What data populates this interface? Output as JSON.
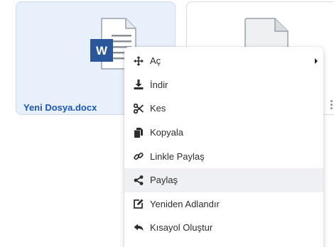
{
  "files": [
    {
      "name": "Yeni Dosya.docx",
      "icon": "word-document-icon",
      "selected": true,
      "accent": "#2b579a"
    },
    {
      "name": "",
      "icon": "generic-document-icon",
      "selected": false
    }
  ],
  "context_menu": {
    "items": [
      {
        "label": "Aç",
        "icon": "move-arrows-icon",
        "has_submenu": true
      },
      {
        "label": "İndir",
        "icon": "download-icon"
      },
      {
        "label": "Kes",
        "icon": "scissors-icon"
      },
      {
        "label": "Kopyala",
        "icon": "copy-icon"
      },
      {
        "label": "Linkle Paylaş",
        "icon": "link-icon"
      },
      {
        "label": "Paylaş",
        "icon": "share-icon",
        "highlighted": true
      },
      {
        "label": "Yeniden Adlandır",
        "icon": "edit-icon"
      },
      {
        "label": "Kısayol Oluştur",
        "icon": "shortcut-arrow-icon"
      }
    ]
  },
  "colors": {
    "selection_bg": "#e8f0fc",
    "file_name": "#1a55b8",
    "menu_hover": "#eef0f3"
  }
}
